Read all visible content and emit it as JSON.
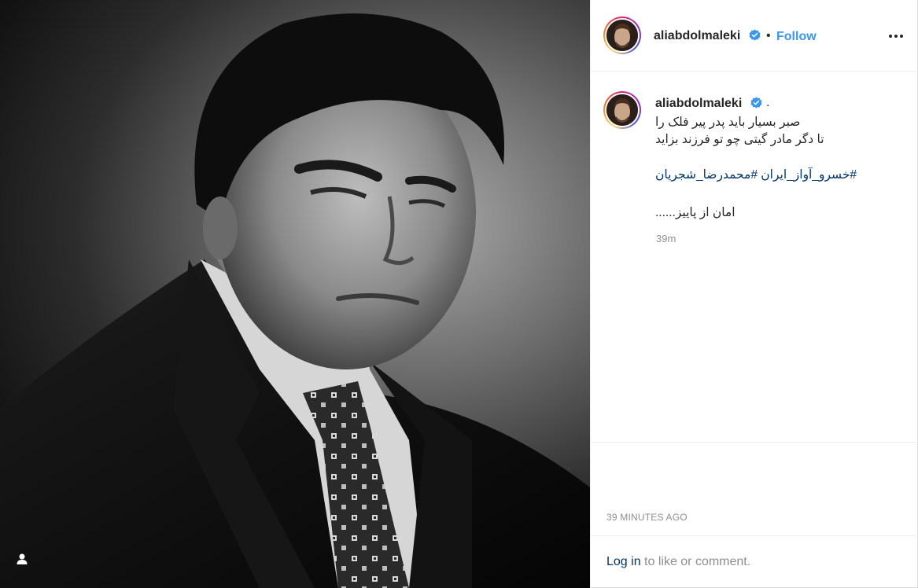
{
  "post": {
    "image_alt": "Black and white portrait photo",
    "user_tag_icon": "person-icon"
  },
  "header": {
    "username": "aliabdolmaleki",
    "verified_icon": "verified-badge-icon",
    "separator": "•",
    "follow_label": "Follow",
    "more_icon": "more-horizontal-icon"
  },
  "caption": {
    "username": "aliabdolmaleki",
    "trailing_dot": ".",
    "line1": "صبر بسیار باید پدر پیر فلک را",
    "line2": "تا دگر مادر گیتی چو تو فرزند بزاید",
    "hashtag1": "#خسرو_آواز_ایران",
    "hashtag2": "#محمدرضا_شجریان",
    "line4": "امان از پاییز......",
    "relative_time": "39m"
  },
  "footer": {
    "timestamp": "39 MINUTES AGO",
    "login_link": "Log in",
    "login_suffix": " to like or comment."
  },
  "colors": {
    "accent": "#3897f0",
    "link": "#003569",
    "muted": "#8e8e8e",
    "text": "#262626"
  }
}
